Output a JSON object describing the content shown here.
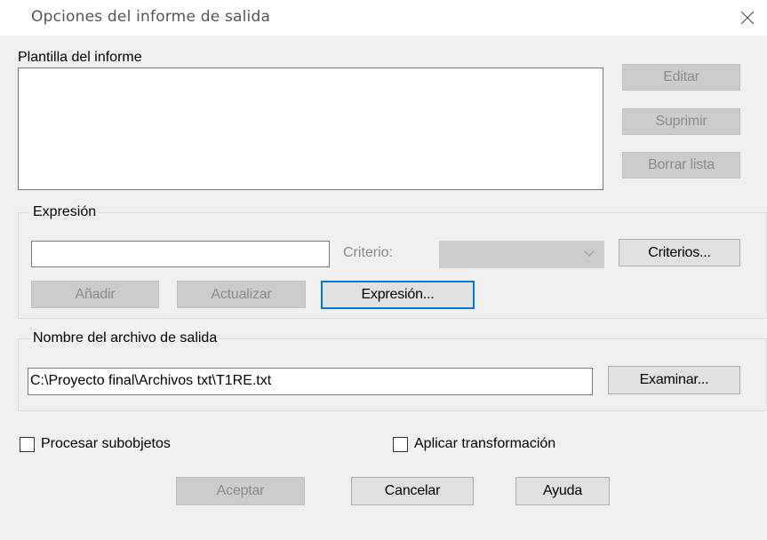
{
  "dialog": {
    "title": "Opciones del informe de salida",
    "close_icon": "close-icon"
  },
  "template": {
    "label": "Plantilla del informe",
    "items": []
  },
  "side_buttons": {
    "edit": "Editar",
    "delete": "Suprimir",
    "clear": "Borrar lista"
  },
  "expression": {
    "group_label": "Expresión",
    "value": "",
    "criterion_label": "Criterio:",
    "criterion_value": "",
    "criteria_button": "Criterios...",
    "add_button": "Añadir",
    "update_button": "Actualizar",
    "expression_button": "Expresión..."
  },
  "output": {
    "group_label": "Nombre del archivo de salida",
    "path": "C:\\Proyecto final\\Archivos txt\\T1RE.txt",
    "browse_button": "Examinar..."
  },
  "options": {
    "process_subobjects": {
      "label": "Procesar subobjetos",
      "checked": false
    },
    "apply_transform": {
      "label": "Aplicar transformación",
      "checked": false
    }
  },
  "footer": {
    "accept": "Aceptar",
    "cancel": "Cancelar",
    "help": "Ayuda"
  }
}
